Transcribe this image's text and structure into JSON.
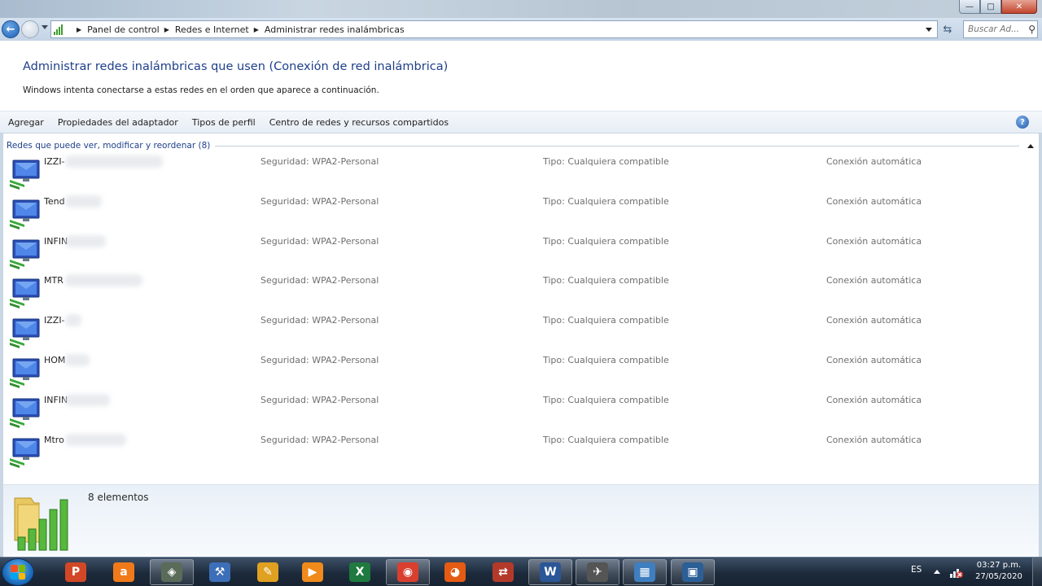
{
  "window": {
    "controls": {
      "minimize": "—",
      "maximize": "□",
      "close": "✕"
    }
  },
  "address_bar": {
    "breadcrumbs": [
      "Panel de control",
      "Redes e Internet",
      "Administrar redes inalámbricas"
    ],
    "search_placeholder": "Buscar Ad..."
  },
  "header": {
    "title": "Administrar redes inalámbricas que usen (Conexión de red inalámbrica)",
    "subtitle": "Windows intenta conectarse a estas redes en el orden que aparece a continuación."
  },
  "command_bar": {
    "items": [
      "Agregar",
      "Propiedades del adaptador",
      "Tipos de perfil",
      "Centro de redes y recursos compartidos"
    ]
  },
  "group": {
    "label": "Redes que puede ver, modificar y reordenar (8)"
  },
  "networks": [
    {
      "name": "IZZI-",
      "security": "Seguridad:  WPA2-Personal",
      "type": "Tipo:  Cualquiera compatible",
      "mode": "Conexión automática"
    },
    {
      "name": "Tend",
      "security": "Seguridad:  WPA2-Personal",
      "type": "Tipo:  Cualquiera compatible",
      "mode": "Conexión automática"
    },
    {
      "name": "INFIN",
      "security": "Seguridad:  WPA2-Personal",
      "type": "Tipo:  Cualquiera compatible",
      "mode": "Conexión automática"
    },
    {
      "name": "MTR",
      "security": "Seguridad:  WPA2-Personal",
      "type": "Tipo:  Cualquiera compatible",
      "mode": "Conexión automática"
    },
    {
      "name": "IZZI-",
      "security": "Seguridad:  WPA2-Personal",
      "type": "Tipo:  Cualquiera compatible",
      "mode": "Conexión automática"
    },
    {
      "name": "HOM",
      "security": "Seguridad:  WPA2-Personal",
      "type": "Tipo:  Cualquiera compatible",
      "mode": "Conexión automática"
    },
    {
      "name": "INFIN",
      "security": "Seguridad:  WPA2-Personal",
      "type": "Tipo:  Cualquiera compatible",
      "mode": "Conexión automática"
    },
    {
      "name": "Mtro",
      "security": "Seguridad:  WPA2-Personal",
      "type": "Tipo:  Cualquiera compatible",
      "mode": "Conexión automática"
    }
  ],
  "details": {
    "count": "8 elementos"
  },
  "taskbar": {
    "apps": [
      {
        "name": "powerpoint",
        "glyph": "P",
        "color": "#d24726"
      },
      {
        "name": "avast",
        "glyph": "a",
        "color": "#f07a1a"
      },
      {
        "name": "virtualbox",
        "glyph": "◈",
        "color": "#5a6b5a"
      },
      {
        "name": "tool",
        "glyph": "⚒",
        "color": "#3c6fb8"
      },
      {
        "name": "illustrator",
        "glyph": "✎",
        "color": "#e0a020"
      },
      {
        "name": "media",
        "glyph": "▶",
        "color": "#f08a1a"
      },
      {
        "name": "excel",
        "glyph": "X",
        "color": "#1f7a3f"
      },
      {
        "name": "chrome",
        "glyph": "◉",
        "color": "#d93f2f"
      },
      {
        "name": "firefox",
        "glyph": "◕",
        "color": "#e55b13"
      },
      {
        "name": "filezilla",
        "glyph": "⇄",
        "color": "#b33a2b"
      },
      {
        "name": "word",
        "glyph": "W",
        "color": "#2b5797"
      },
      {
        "name": "network",
        "glyph": "✈",
        "color": "#555"
      },
      {
        "name": "control-panel",
        "glyph": "▦",
        "color": "#3f7fc0"
      },
      {
        "name": "explorer",
        "glyph": "▣",
        "color": "#2c5f96"
      }
    ],
    "language": "ES",
    "time": "03:27 p.m.",
    "date": "27/05/2020"
  }
}
